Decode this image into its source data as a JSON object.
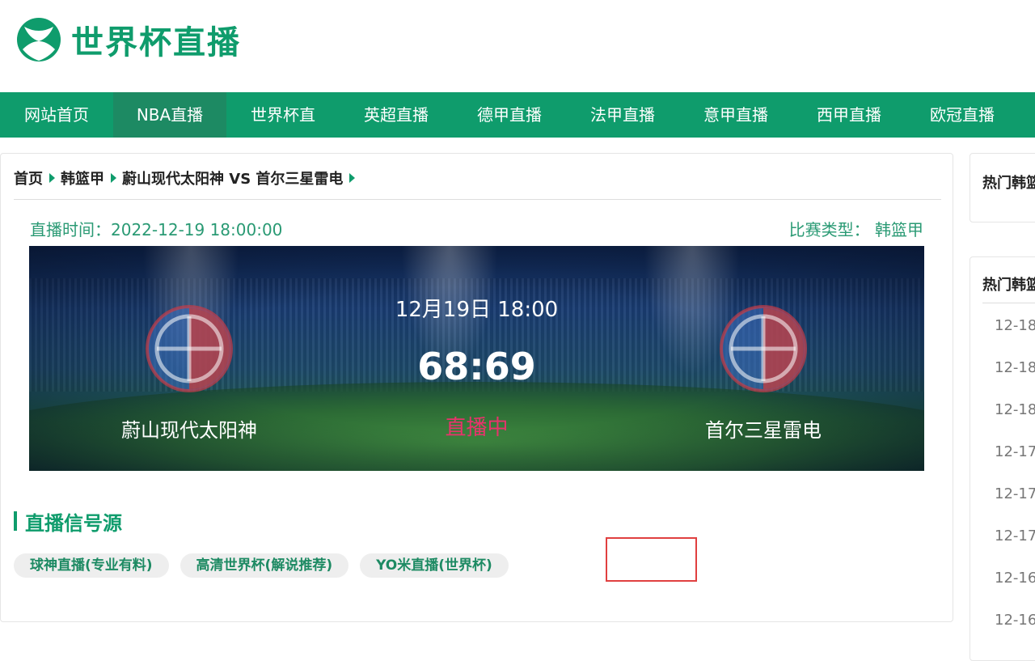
{
  "brand": {
    "logo_text": "世界杯直播"
  },
  "nav": {
    "items": [
      {
        "label": "网站首页"
      },
      {
        "label": "NBA直播"
      },
      {
        "label": "世界杯直"
      },
      {
        "label": "英超直播"
      },
      {
        "label": "德甲直播"
      },
      {
        "label": "法甲直播"
      },
      {
        "label": "意甲直播"
      },
      {
        "label": "西甲直播"
      },
      {
        "label": "欧冠直播"
      }
    ]
  },
  "breadcrumb": [
    "首页",
    "韩篮甲",
    "蔚山现代太阳神 VS 首尔三星雷电"
  ],
  "match": {
    "live_time": "直播时间：2022-12-19 18:00:00",
    "match_type": "比赛类型：  韩篮甲",
    "date_time": "12月19日 18:00",
    "score": "68:69",
    "status": "直播中",
    "home_team": "蔚山现代太阳神",
    "away_team": "首尔三星雷电"
  },
  "sources": {
    "title": "直播信号源",
    "items": [
      {
        "label": "球神直播(专业有料)"
      },
      {
        "label": "高清世界杯(解说推荐)"
      },
      {
        "label": "YO米直播(世界杯)"
      }
    ]
  },
  "sidebar": {
    "card1_title": "热门韩篮",
    "card2_title": "热门韩篮",
    "items": [
      "12-18",
      "12-18",
      "12-18",
      "12-17",
      "12-17",
      "12-17",
      "12-16",
      "12-16"
    ]
  },
  "colors": {
    "brand_green": "#0f9c6c",
    "live_pink": "#e8336c",
    "highlight_red": "#e04040"
  }
}
